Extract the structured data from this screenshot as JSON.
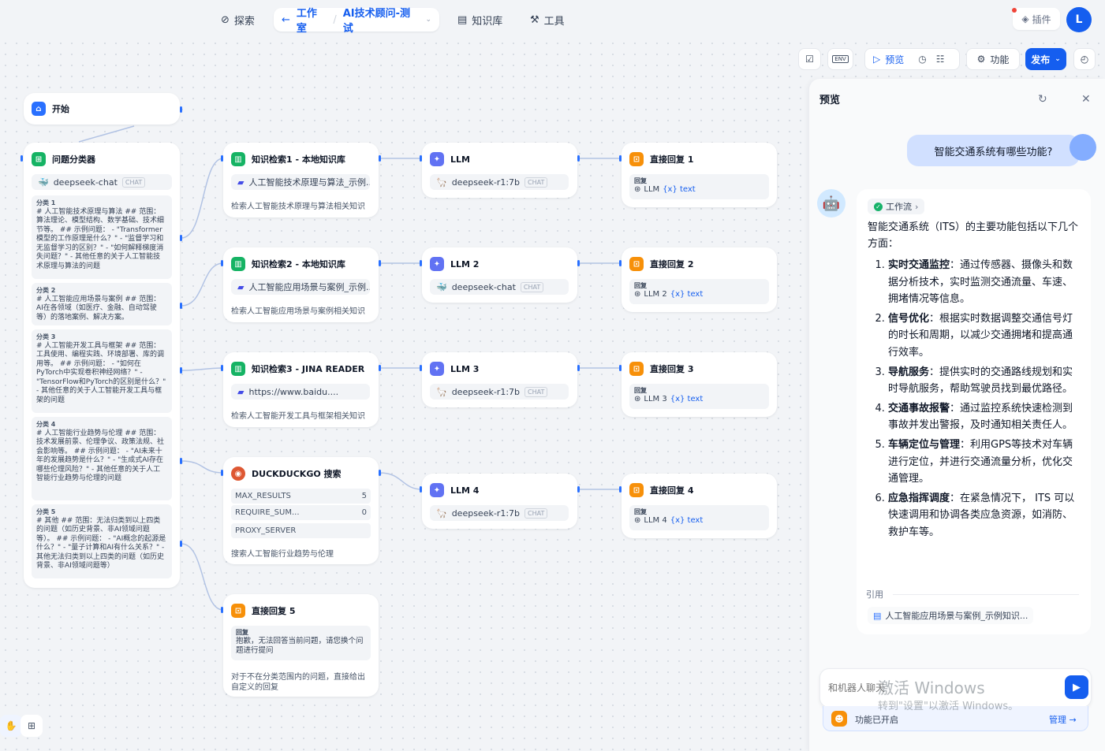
{
  "nav": {
    "explore": "探索",
    "studio": "工作室",
    "app_name": "AI技术顾问-测试",
    "knowledge": "知识库",
    "tools": "工具",
    "plugins": "插件",
    "avatar_letter": "L"
  },
  "toolbar": {
    "env": "ENV",
    "preview": "预览",
    "features": "功能",
    "publish": "发布"
  },
  "nodes": {
    "start": {
      "title": "开始"
    },
    "classifier": {
      "title": "问题分类器",
      "model": "deepseek-chat",
      "model_tag": "CHAT",
      "classes": [
        {
          "label": "分类 1",
          "text": "# 人工智能技术原理与算法 ## 范围：算法理论、模型结构、数学基础、技术细节等。 ## 示例问题： - \"Transformer模型的工作原理是什么？\" - \"监督学习和无监督学习的区别？\" - \"如何解释梯度消失问题？\" - 其他任意的关于人工智能技术原理与算法的问题"
        },
        {
          "label": "分类 2",
          "text": "# 人工智能应用场景与案例 ## 范围：AI在各领域（如医疗、金融、自动驾驶等）的落地案例、解决方案。"
        },
        {
          "label": "分类 3",
          "text": "# 人工智能开发工具与框架 ## 范围：工具使用、编程实践、环境部署、库的调用等。 ## 示例问题： - \"如何在PyTorch中实现卷积神经网络？\" - \"TensorFlow和PyTorch的区别是什么？\" - 其他任意的关于人工智能开发工具与框架的问题"
        },
        {
          "label": "分类 4",
          "text": "# 人工智能行业趋势与伦理 ## 范围：技术发展前景、伦理争议、政策法规、社会影响等。 ## 示例问题： - \"AI未来十年的发展趋势是什么？\" - \"生成式AI存在哪些伦理风险？\" - 其他任意的关于人工智能行业趋势与伦理的问题"
        },
        {
          "label": "分类 5",
          "text": "# 其他 ## 范围：无法归类到以上四类的问题（如历史背景、非AI领域问题等）。 ## 示例问题： - \"AI概念的起源是什么？\" - \"量子计算和AI有什么关系？\" - 其他无法归类到以上四类的问题（如历史背景、非AI领域问题等）"
        }
      ]
    },
    "kr1": {
      "title": "知识检索1 - 本地知识库",
      "dataset": "人工智能技术原理与算法_示例...",
      "desc": "检索人工智能技术原理与算法相关知识"
    },
    "kr2": {
      "title": "知识检索2 - 本地知识库",
      "dataset": "人工智能应用场景与案例_示例...",
      "desc": "检索人工智能应用场景与案例相关知识"
    },
    "kr3": {
      "title": "知识检索3 - JINA READER",
      "dataset": "https://www.baidu....",
      "desc": "检索人工智能开发工具与框架相关知识"
    },
    "ddg": {
      "title": "DUCKDUCKGO 搜索",
      "params": [
        {
          "name": "MAX_RESULTS",
          "value": "5"
        },
        {
          "name": "REQUIRE_SUM...",
          "value": "0"
        },
        {
          "name": "PROXY_SERVER",
          "value": ""
        }
      ],
      "desc": "搜索人工智能行业趋势与伦理"
    },
    "llm1": {
      "title": "LLM",
      "model": "deepseek-r1:7b",
      "tag": "CHAT"
    },
    "llm2": {
      "title": "LLM 2",
      "model": "deepseek-chat",
      "tag": "CHAT"
    },
    "llm3": {
      "title": "LLM 3",
      "model": "deepseek-r1:7b",
      "tag": "CHAT"
    },
    "llm4": {
      "title": "LLM 4",
      "model": "deepseek-r1:7b",
      "tag": "CHAT"
    },
    "ans1": {
      "title": "直接回复 1",
      "out_label": "回复",
      "src": "LLM",
      "var": "{x} text"
    },
    "ans2": {
      "title": "直接回复 2",
      "out_label": "回复",
      "src": "LLM 2",
      "var": "{x} text"
    },
    "ans3": {
      "title": "直接回复 3",
      "out_label": "回复",
      "src": "LLM 3",
      "var": "{x} text"
    },
    "ans4": {
      "title": "直接回复 4",
      "out_label": "回复",
      "src": "LLM 4",
      "var": "{x} text"
    },
    "ans5": {
      "title": "直接回复 5",
      "out_label": "回复",
      "text": "抱歉，无法回答当前问题，请您换个问题进行提问",
      "desc1": "对于不在分类范围内的问题，直接给出",
      "desc2": "自定义的回复"
    }
  },
  "preview": {
    "title": "预览",
    "user_question": "智能交通系统有哪些功能?",
    "workflow_label": "工作流",
    "intro": "智能交通系统（ITS）的主要功能包括以下几个方面：",
    "points": [
      {
        "bold": "实时交通监控",
        "text": "：通过传感器、摄像头和数据分析技术，实时监测交通流量、车速、拥堵情况等信息。"
      },
      {
        "bold": "信号优化",
        "text": "：根据实时数据调整交通信号灯的时长和周期，以减少交通拥堵和提高通行效率。"
      },
      {
        "bold": "导航服务",
        "text": "：提供实时的交通路线规划和实时导航服务，帮助驾驶员找到最优路径。"
      },
      {
        "bold": "交通事故报警",
        "text": "：通过监控系统快速检测到事故并发出警报，及时通知相关责任人。"
      },
      {
        "bold": "车辆定位与管理",
        "text": "：利用GPS等技术对车辆进行定位，并进行交通流量分析，优化交通管理。"
      },
      {
        "bold": "应急指挥调度",
        "text": "：在紧急情况下， ITS 可以快速调用和协调各类应急资源，如消防、救护车等。"
      }
    ],
    "citation_label": "引用",
    "citation": "人工智能应用场景与案例_示例知识...",
    "input_placeholder": "和机器人聊天",
    "features_on": "功能已开启",
    "manage": "管理 →",
    "watermark1": "激活 Windows",
    "watermark2": "转到\"设置\"以激活 Windows。"
  },
  "colors": {
    "accent": "#155eef",
    "green": "#16b364",
    "orange": "#f79009",
    "indigo": "#6172f3"
  }
}
